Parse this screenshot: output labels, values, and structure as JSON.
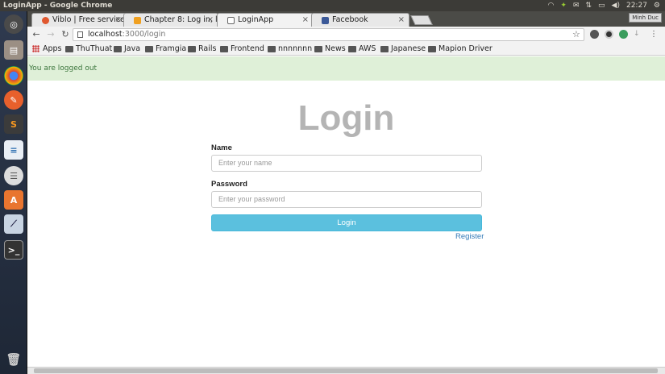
{
  "system": {
    "window_title": "LoginApp - Google Chrome",
    "clock": "22:27",
    "user_badge": "Minh Duc"
  },
  "tabs": [
    {
      "label": "Viblo | Free service",
      "color": "#e0582f"
    },
    {
      "label": "Chapter 8: Log in, lo",
      "color": "#f0a020"
    },
    {
      "label": "LoginApp",
      "color": "#ffffff"
    },
    {
      "label": "Facebook",
      "color": "#3b5998"
    }
  ],
  "address": {
    "host": "localhost",
    "path": ":3000/login"
  },
  "bookmarks": [
    "Apps",
    "ThuThuat",
    "Java",
    "Framgia",
    "Rails",
    "Frontend",
    "nnnnnnn",
    "News",
    "AWS",
    "Japanese",
    "Mapion Driver"
  ],
  "page": {
    "alert": "You are logged out",
    "title": "Login",
    "name_label": "Name",
    "name_placeholder": "Enter your name",
    "password_label": "Password",
    "password_placeholder": "Enter your password",
    "login_button": "Login",
    "register_link": "Register"
  },
  "colors": {
    "alert_bg": "#dff0d8",
    "button": "#5bc0de",
    "link": "#337ab7"
  }
}
